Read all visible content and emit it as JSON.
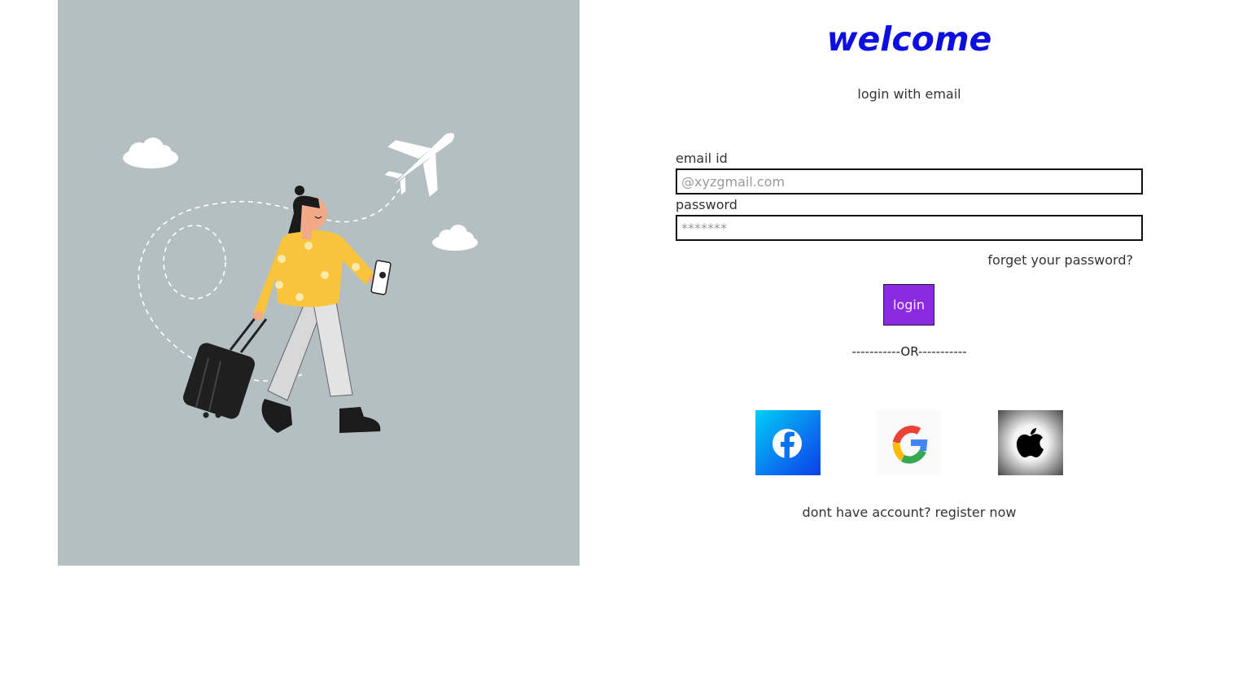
{
  "header": {
    "title": "welcome",
    "subtitle": "login with email"
  },
  "form": {
    "email_label": "email id",
    "email_placeholder": "@xyzgmail.com",
    "password_label": "password",
    "password_placeholder": "*******",
    "forgot_link": "forget your password?",
    "login_button": "login",
    "divider": "-----------OR-----------"
  },
  "social": [
    {
      "name": "facebook",
      "icon": "facebook-icon",
      "color": "#0a74f0"
    },
    {
      "name": "google",
      "icon": "google-icon",
      "color": "#ea4335"
    },
    {
      "name": "apple",
      "icon": "apple-icon",
      "color": "#000000"
    }
  ],
  "footer": {
    "register_text": "dont have account? register now"
  },
  "colors": {
    "hero_background": "#b4bfc3",
    "title": "#0c0fe0",
    "login_button": "#8a2be2"
  }
}
